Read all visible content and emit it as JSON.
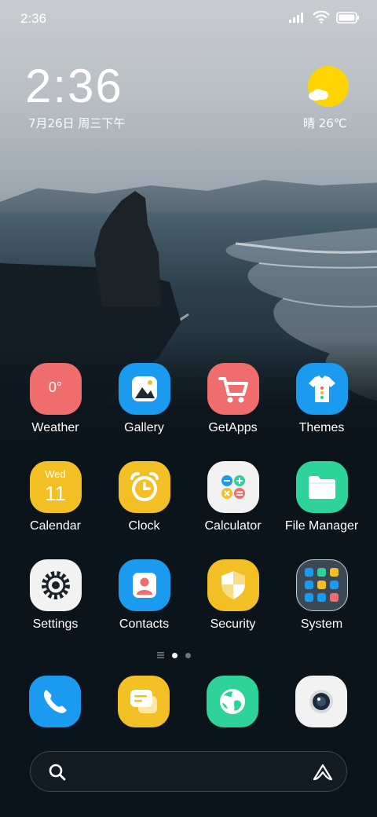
{
  "status_bar": {
    "time": "2:36"
  },
  "clock_widget": {
    "time": "2:36",
    "date": "7月26日 周三下午"
  },
  "weather_widget": {
    "text": "晴 26℃"
  },
  "apps": [
    {
      "label": "Weather",
      "badge_text": "0°",
      "color": "#f06d6d"
    },
    {
      "label": "Gallery",
      "color": "#1a9bf0"
    },
    {
      "label": "GetApps",
      "color": "#f06d6d"
    },
    {
      "label": "Themes",
      "color": "#1a9bf0"
    },
    {
      "label": "Calendar",
      "day": "Wed",
      "date": "11",
      "color": "#f2c024"
    },
    {
      "label": "Clock",
      "color": "#f2c024"
    },
    {
      "label": "Calculator",
      "color": "#f2f2f2"
    },
    {
      "label": "File Manager",
      "color": "#2ed39a"
    },
    {
      "label": "Settings",
      "color": "#f2f2f2"
    },
    {
      "label": "Contacts",
      "color": "#1a9bf0"
    },
    {
      "label": "Security",
      "color": "#f2c024"
    },
    {
      "label": "System",
      "color": "#3b4855"
    }
  ],
  "dock": [
    {
      "name": "Phone",
      "color": "#1a9bf0"
    },
    {
      "name": "Messages",
      "color": "#f2c024"
    },
    {
      "name": "Browser",
      "color": "#2ed39a"
    },
    {
      "name": "Camera",
      "color": "#f2f2f2"
    }
  ],
  "page_indicator": {
    "pages": 2,
    "active": 1
  }
}
